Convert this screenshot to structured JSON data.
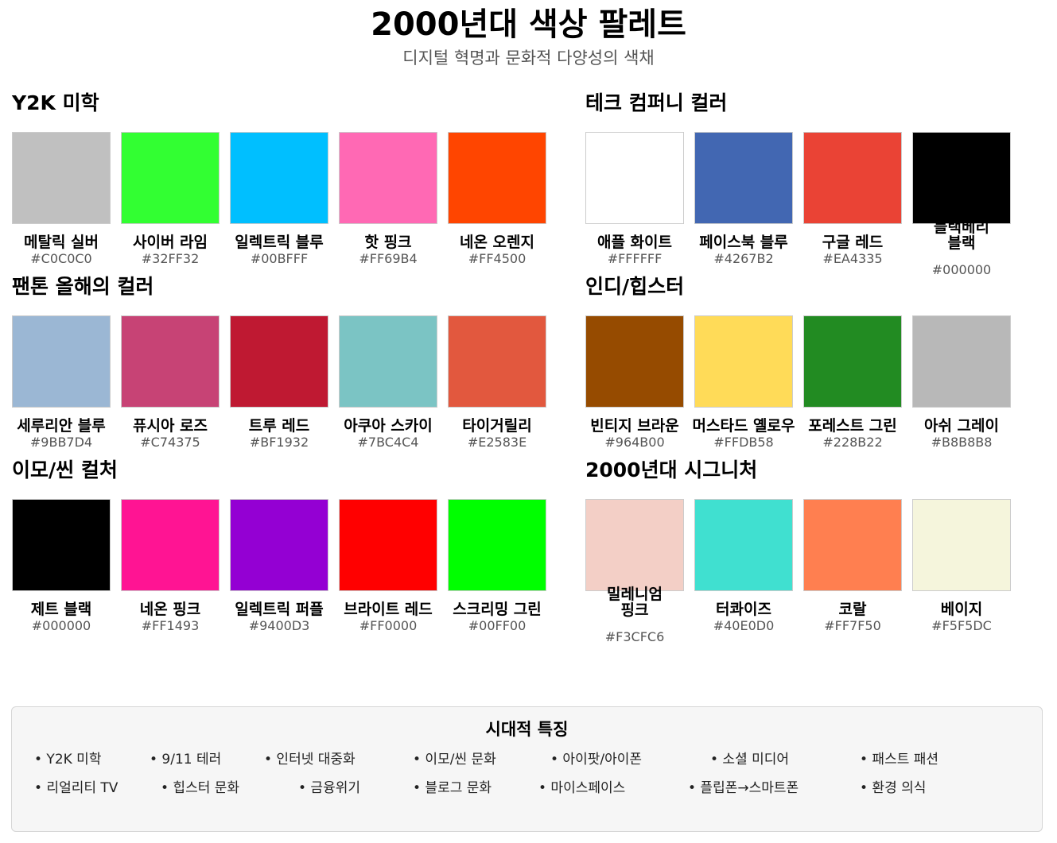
{
  "header": {
    "title": "2000년대 색상 팔레트",
    "subtitle": "디지털 혁명과 문화적 다양성의 색채"
  },
  "sections": [
    {
      "title": "Y2K 미학",
      "colors": [
        {
          "name": "메탈릭 실버",
          "hex": "#C0C0C0"
        },
        {
          "name": "사이버 라임",
          "hex": "#32FF32"
        },
        {
          "name": "일렉트릭 블루",
          "hex": "#00BFFF"
        },
        {
          "name": "핫 핑크",
          "hex": "#FF69B4"
        },
        {
          "name": "네온 오렌지",
          "hex": "#FF4500"
        }
      ]
    },
    {
      "title": "테크 컴퍼니 컬러",
      "colors": [
        {
          "name": "애플 화이트",
          "hex": "#FFFFFF"
        },
        {
          "name": "페이스북 블루",
          "hex": "#4267B2"
        },
        {
          "name": "구글 레드",
          "hex": "#EA4335"
        },
        {
          "name": "블랙베리 블랙",
          "hex": "#000000"
        }
      ]
    },
    {
      "title": "팬톤 올해의 컬러",
      "colors": [
        {
          "name": "세루리안 블루",
          "hex": "#9BB7D4"
        },
        {
          "name": "퓨시아 로즈",
          "hex": "#C74375"
        },
        {
          "name": "트루 레드",
          "hex": "#BF1932"
        },
        {
          "name": "아쿠아 스카이",
          "hex": "#7BC4C4"
        },
        {
          "name": "타이거릴리",
          "hex": "#E2583E"
        }
      ]
    },
    {
      "title": "인디/힙스터",
      "colors": [
        {
          "name": "빈티지 브라운",
          "hex": "#964B00"
        },
        {
          "name": "머스타드 옐로우",
          "hex": "#FFDB58"
        },
        {
          "name": "포레스트 그린",
          "hex": "#228B22"
        },
        {
          "name": "아쉬 그레이",
          "hex": "#B8B8B8"
        }
      ]
    },
    {
      "title": "이모/씬 컬처",
      "colors": [
        {
          "name": "제트 블랙",
          "hex": "#000000"
        },
        {
          "name": "네온 핑크",
          "hex": "#FF1493"
        },
        {
          "name": "일렉트릭 퍼플",
          "hex": "#9400D3"
        },
        {
          "name": "브라이트 레드",
          "hex": "#FF0000"
        },
        {
          "name": "스크리밍 그린",
          "hex": "#00FF00"
        }
      ]
    },
    {
      "title": "2000년대 시그니처",
      "colors": [
        {
          "name": "밀레니엄 핑크",
          "hex": "#F3CFC6"
        },
        {
          "name": "터콰이즈",
          "hex": "#40E0D0"
        },
        {
          "name": "코랄",
          "hex": "#FF7F50"
        },
        {
          "name": "베이지",
          "hex": "#F5F5DC"
        }
      ]
    }
  ],
  "footer": {
    "title": "시대적 특징",
    "traits": [
      "• Y2K 미학",
      "• 9/11 테러",
      "• 인터넷 대중화",
      "• 이모/씬 문화",
      "• 아이팟/아이폰",
      "• 소셜 미디어",
      "• 패스트 패션",
      "• 리얼리티 TV",
      "• 힙스터 문화",
      "• 금융위기",
      "• 블로그 문화",
      "• 마이스페이스",
      "• 플립폰→스마트폰",
      "• 환경 의식"
    ]
  }
}
